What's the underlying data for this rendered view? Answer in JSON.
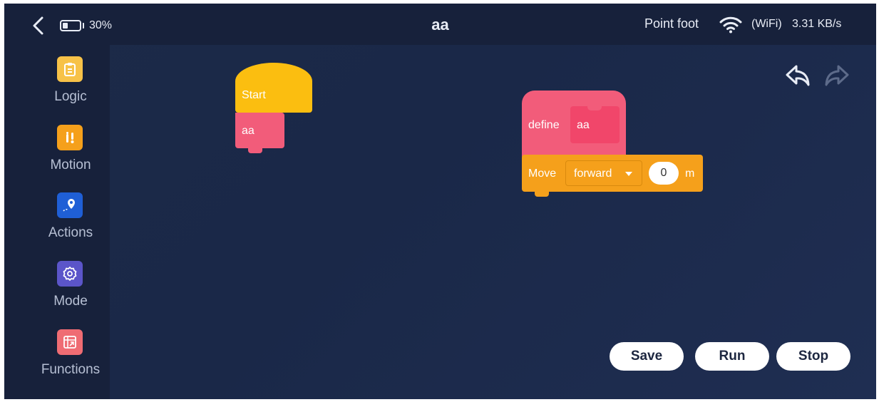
{
  "header": {
    "battery_text": "30%",
    "battery_level": 0.3,
    "title": "aa",
    "robot_name": "Point foot",
    "wifi_label": "(WiFi)",
    "speed": "3.31 KB/s"
  },
  "sidebar": {
    "items": [
      {
        "label": "Logic",
        "icon": "clipboard-icon",
        "color": "#f7c248"
      },
      {
        "label": "Motion",
        "icon": "motion-icon",
        "color": "#f5a01b"
      },
      {
        "label": "Actions",
        "icon": "location-pin-icon",
        "color": "#1f5fd6"
      },
      {
        "label": "Mode",
        "icon": "gear-icon",
        "color": "#5b55c9"
      },
      {
        "label": "Functions",
        "icon": "function-icon",
        "color": "#ef6c73"
      }
    ]
  },
  "blocks": {
    "start_label": "Start",
    "call_label": "aa",
    "define_label": "define",
    "define_name": "aa",
    "move_label": "Move",
    "move_direction": "forward",
    "move_distance": "0",
    "move_unit": "m"
  },
  "actions": {
    "save": "Save",
    "run": "Run",
    "stop": "Stop"
  },
  "colors": {
    "start": "#fbbe10",
    "function": "#f25c7a",
    "motion": "#f5a01b",
    "background": "#1c2a48"
  }
}
